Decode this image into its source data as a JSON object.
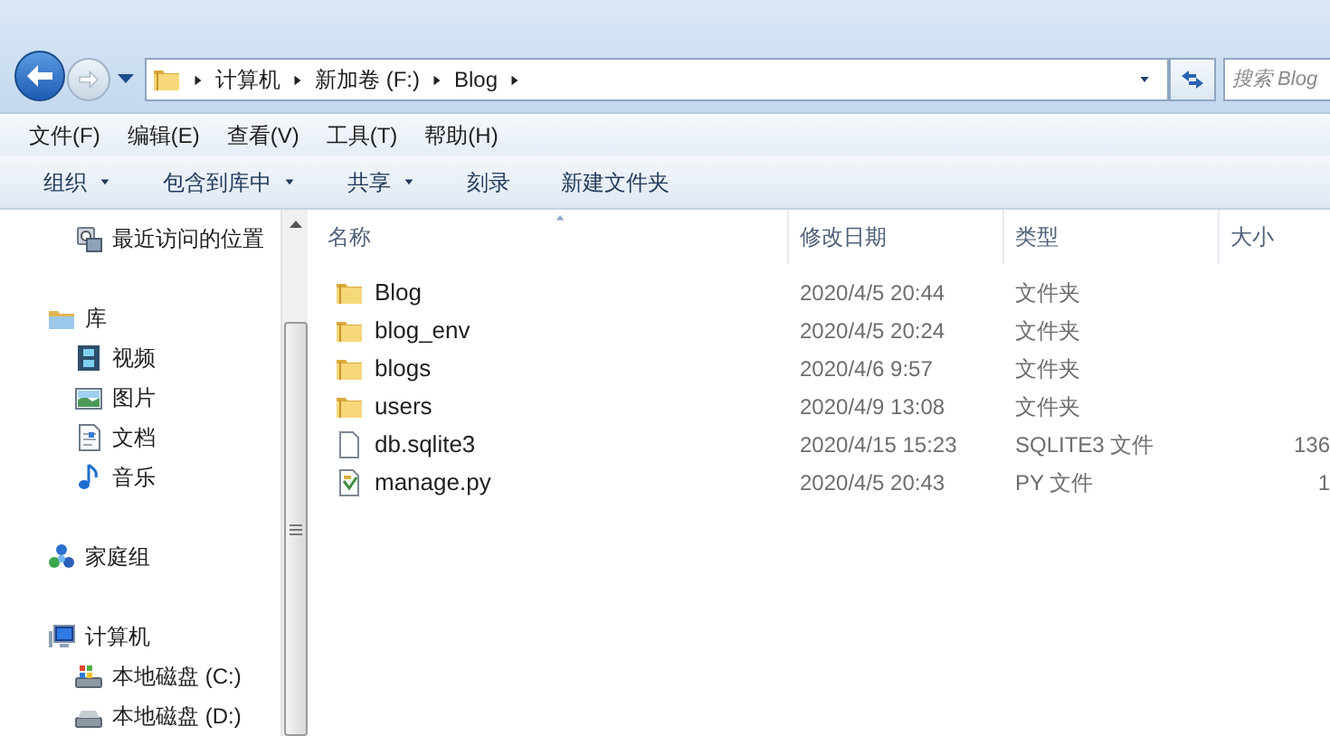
{
  "address_bar": {
    "segments": [
      "计算机",
      "新加卷 (F:)",
      "Blog"
    ]
  },
  "search": {
    "placeholder": "搜索 Blog"
  },
  "menu_bar": [
    "文件(F)",
    "编辑(E)",
    "查看(V)",
    "工具(T)",
    "帮助(H)"
  ],
  "toolbar": [
    {
      "label": "组织",
      "dropdown": true
    },
    {
      "label": "包含到库中",
      "dropdown": true
    },
    {
      "label": "共享",
      "dropdown": true
    },
    {
      "label": "刻录",
      "dropdown": false
    },
    {
      "label": "新建文件夹",
      "dropdown": false
    }
  ],
  "nav_pane": [
    {
      "label": "最近访问的位置",
      "kind": "recent"
    },
    {
      "label": "库",
      "kind": "library",
      "children": [
        {
          "label": "视频",
          "kind": "video"
        },
        {
          "label": "图片",
          "kind": "picture"
        },
        {
          "label": "文档",
          "kind": "document"
        },
        {
          "label": "音乐",
          "kind": "music"
        }
      ]
    },
    {
      "label": "家庭组",
      "kind": "homegroup"
    },
    {
      "label": "计算机",
      "kind": "computer",
      "children": [
        {
          "label": "本地磁盘 (C:)",
          "kind": "system-disk"
        },
        {
          "label": "本地磁盘 (D:)",
          "kind": "disk"
        }
      ]
    }
  ],
  "columns": [
    "名称",
    "修改日期",
    "类型",
    "大小"
  ],
  "files": [
    {
      "name": "Blog",
      "date": "2020/4/5 20:44",
      "type": "文件夹",
      "kind": "folder"
    },
    {
      "name": "blog_env",
      "date": "2020/4/5 20:24",
      "type": "文件夹",
      "kind": "folder"
    },
    {
      "name": "blogs",
      "date": "2020/4/6 9:57",
      "type": "文件夹",
      "kind": "folder"
    },
    {
      "name": "users",
      "date": "2020/4/9 13:08",
      "type": "文件夹",
      "kind": "folder"
    },
    {
      "name": "db.sqlite3",
      "date": "2020/4/15 15:23",
      "type": "SQLITE3 文件",
      "size": "136",
      "kind": "file"
    },
    {
      "name": "manage.py",
      "date": "2020/4/5 20:43",
      "type": "PY 文件",
      "size": "1",
      "kind": "script"
    }
  ]
}
